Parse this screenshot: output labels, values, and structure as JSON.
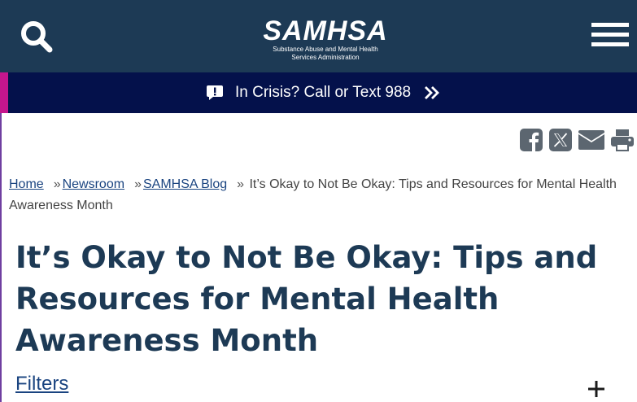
{
  "header": {
    "search_icon": "search-icon",
    "logo_word": "SAMHSA",
    "logo_sub_line1": "Substance Abuse and Mental Health",
    "logo_sub_line2": "Services Administration",
    "menu_icon": "hamburger-menu-icon",
    "bg_color": "#1d3a55"
  },
  "crisis": {
    "icon": "alert-speech-icon",
    "text": "In Crisis? Call or Text 988",
    "arrow_icon": "double-chevron-right-icon",
    "bg_color": "#04114b",
    "accent_color": "#c5168d"
  },
  "share": {
    "items": [
      "facebook-icon",
      "x-icon",
      "email-icon",
      "print-icon"
    ],
    "color": "#5c6670"
  },
  "breadcrumb": {
    "separator": "»",
    "items": [
      {
        "label": "Home",
        "link": true
      },
      {
        "label": "Newsroom",
        "link": true
      },
      {
        "label": "SAMHSA Blog",
        "link": true
      },
      {
        "label": "It’s Okay to Not Be Okay: Tips and Resources for Mental Health Awareness Month",
        "link": false
      }
    ]
  },
  "page": {
    "title": "It’s Okay to Not Be Okay: Tips and Resources for Mental Health Awareness Month",
    "filters_label": "Filters",
    "expand_icon": "plus-icon"
  }
}
